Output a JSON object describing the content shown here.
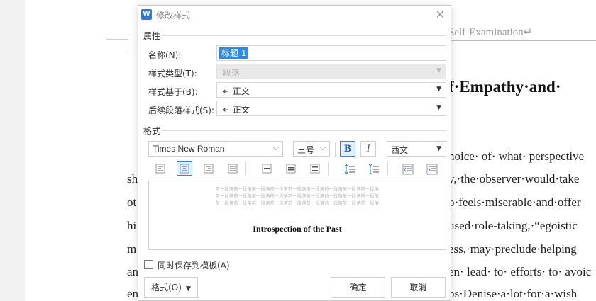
{
  "document": {
    "header_text": "Self-Examination↵",
    "heading": "f·Empathy·and·",
    "left_lines": [
      "sh",
      "ot",
      "hi",
      "m",
      "an",
      "en"
    ],
    "right_lines": [
      "hoice· of· what· perspective",
      "y,·the·observer·would·take",
      "o·feels·miserable·and·offer",
      "used·role-taking,·“egoistic",
      "ess,·may·preclude·helping",
      "en· lead· to· efforts· to· avoic",
      "ps·Denise·a·lot·for·a·wish"
    ]
  },
  "dialog": {
    "title": "修改样式",
    "app_icon_letter": "W",
    "close_glyph": "✕",
    "properties_section": "属性",
    "name_label": "名称(N):",
    "name_value": "标题 1",
    "style_type_label": "样式类型(T):",
    "style_type_value": "段落",
    "based_on_label": "样式基于(B):",
    "based_on_value": "↵ 正文",
    "next_style_label": "后续段落样式(S):",
    "next_style_value": "↵ 正文",
    "format_section": "格式",
    "font_name": "Times New Roman",
    "font_size": "三号",
    "bold_label": "B",
    "italic_label": "I",
    "script_value": "西文",
    "preview_sample": [
      "前一段落前一段落前一段落前一段落前一段落前一段落前一段落前一段落前一段落",
      "前一段落前一段落前一段落前一段落前一段落前一段落前一段落前一段落前一段落",
      "前一段落前一段落前一段落前一段落前一段落前一段落前一段落前一段落前一段落"
    ],
    "preview_text": "Introspection of the Past",
    "save_to_template_label": "同时保存到模板(A)",
    "format_button": "格式(O)",
    "ok_button": "确定",
    "cancel_button": "取消"
  },
  "colors": {
    "accent": "#2a8be6",
    "app_icon": "#2f7bd4"
  }
}
